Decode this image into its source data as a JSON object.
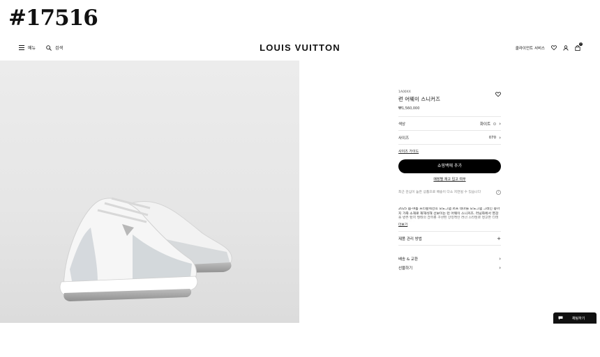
{
  "watermark": "#17516",
  "header": {
    "menu_label": "메뉴",
    "search_label": "검색",
    "brand": "LOUIS VUITTON",
    "client_service": "클라이언트 서비스",
    "cart_count": "0"
  },
  "product": {
    "sku": "1A00XX",
    "name": "런 어웨이 스니커즈",
    "price": "₩1,560,000",
    "color_label": "색상",
    "color_value": "화이트",
    "size_label": "사이즈",
    "size_value": "070",
    "size_guide": "사이즈 가이드",
    "add_to_bag": "쇼핑백에 추가",
    "store_availability": "매장별 재고 입고 여부",
    "notice": "최근 관심이 높은 상품으로 배송이 다소 지연될 수 있습니다",
    "description": "2025 봄-여름 프리컬렉션의 모노그램 퍼프 테마를 모노그램 그래인 송아지 가죽 소재로 재해석해 선보이는 런 어웨이 스니커즈. 러닝화에서 영감을 받은 탑지 형태의 갑피를 구성된 상징적인 러너 스타일로 정교한 디테일을 살렸다.",
    "more": "더보기",
    "care": "제품 관리 방법",
    "delivery": "배송 & 교환",
    "gift": "선물하기"
  },
  "chat": {
    "label": "채팅하기"
  },
  "colors": {
    "brand_black": "#000000",
    "hero_bg": "#e8e8e8"
  }
}
